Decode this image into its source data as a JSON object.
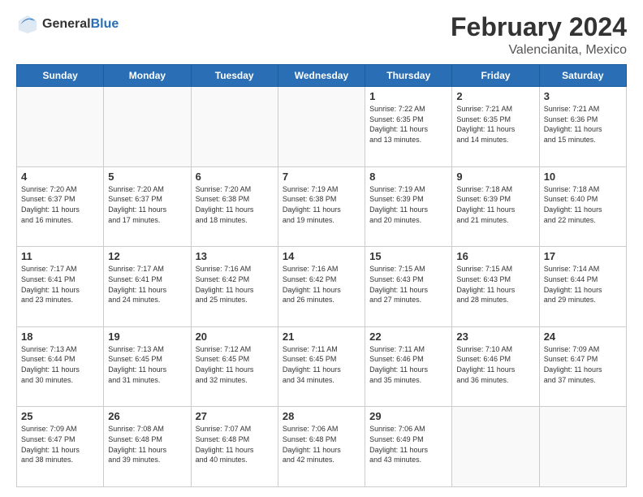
{
  "header": {
    "logo_line1": "General",
    "logo_line2": "Blue",
    "month": "February 2024",
    "location": "Valencianita, Mexico"
  },
  "weekdays": [
    "Sunday",
    "Monday",
    "Tuesday",
    "Wednesday",
    "Thursday",
    "Friday",
    "Saturday"
  ],
  "weeks": [
    [
      {
        "day": "",
        "info": ""
      },
      {
        "day": "",
        "info": ""
      },
      {
        "day": "",
        "info": ""
      },
      {
        "day": "",
        "info": ""
      },
      {
        "day": "1",
        "info": "Sunrise: 7:22 AM\nSunset: 6:35 PM\nDaylight: 11 hours\nand 13 minutes."
      },
      {
        "day": "2",
        "info": "Sunrise: 7:21 AM\nSunset: 6:35 PM\nDaylight: 11 hours\nand 14 minutes."
      },
      {
        "day": "3",
        "info": "Sunrise: 7:21 AM\nSunset: 6:36 PM\nDaylight: 11 hours\nand 15 minutes."
      }
    ],
    [
      {
        "day": "4",
        "info": "Sunrise: 7:20 AM\nSunset: 6:37 PM\nDaylight: 11 hours\nand 16 minutes."
      },
      {
        "day": "5",
        "info": "Sunrise: 7:20 AM\nSunset: 6:37 PM\nDaylight: 11 hours\nand 17 minutes."
      },
      {
        "day": "6",
        "info": "Sunrise: 7:20 AM\nSunset: 6:38 PM\nDaylight: 11 hours\nand 18 minutes."
      },
      {
        "day": "7",
        "info": "Sunrise: 7:19 AM\nSunset: 6:38 PM\nDaylight: 11 hours\nand 19 minutes."
      },
      {
        "day": "8",
        "info": "Sunrise: 7:19 AM\nSunset: 6:39 PM\nDaylight: 11 hours\nand 20 minutes."
      },
      {
        "day": "9",
        "info": "Sunrise: 7:18 AM\nSunset: 6:39 PM\nDaylight: 11 hours\nand 21 minutes."
      },
      {
        "day": "10",
        "info": "Sunrise: 7:18 AM\nSunset: 6:40 PM\nDaylight: 11 hours\nand 22 minutes."
      }
    ],
    [
      {
        "day": "11",
        "info": "Sunrise: 7:17 AM\nSunset: 6:41 PM\nDaylight: 11 hours\nand 23 minutes."
      },
      {
        "day": "12",
        "info": "Sunrise: 7:17 AM\nSunset: 6:41 PM\nDaylight: 11 hours\nand 24 minutes."
      },
      {
        "day": "13",
        "info": "Sunrise: 7:16 AM\nSunset: 6:42 PM\nDaylight: 11 hours\nand 25 minutes."
      },
      {
        "day": "14",
        "info": "Sunrise: 7:16 AM\nSunset: 6:42 PM\nDaylight: 11 hours\nand 26 minutes."
      },
      {
        "day": "15",
        "info": "Sunrise: 7:15 AM\nSunset: 6:43 PM\nDaylight: 11 hours\nand 27 minutes."
      },
      {
        "day": "16",
        "info": "Sunrise: 7:15 AM\nSunset: 6:43 PM\nDaylight: 11 hours\nand 28 minutes."
      },
      {
        "day": "17",
        "info": "Sunrise: 7:14 AM\nSunset: 6:44 PM\nDaylight: 11 hours\nand 29 minutes."
      }
    ],
    [
      {
        "day": "18",
        "info": "Sunrise: 7:13 AM\nSunset: 6:44 PM\nDaylight: 11 hours\nand 30 minutes."
      },
      {
        "day": "19",
        "info": "Sunrise: 7:13 AM\nSunset: 6:45 PM\nDaylight: 11 hours\nand 31 minutes."
      },
      {
        "day": "20",
        "info": "Sunrise: 7:12 AM\nSunset: 6:45 PM\nDaylight: 11 hours\nand 32 minutes."
      },
      {
        "day": "21",
        "info": "Sunrise: 7:11 AM\nSunset: 6:45 PM\nDaylight: 11 hours\nand 34 minutes."
      },
      {
        "day": "22",
        "info": "Sunrise: 7:11 AM\nSunset: 6:46 PM\nDaylight: 11 hours\nand 35 minutes."
      },
      {
        "day": "23",
        "info": "Sunrise: 7:10 AM\nSunset: 6:46 PM\nDaylight: 11 hours\nand 36 minutes."
      },
      {
        "day": "24",
        "info": "Sunrise: 7:09 AM\nSunset: 6:47 PM\nDaylight: 11 hours\nand 37 minutes."
      }
    ],
    [
      {
        "day": "25",
        "info": "Sunrise: 7:09 AM\nSunset: 6:47 PM\nDaylight: 11 hours\nand 38 minutes."
      },
      {
        "day": "26",
        "info": "Sunrise: 7:08 AM\nSunset: 6:48 PM\nDaylight: 11 hours\nand 39 minutes."
      },
      {
        "day": "27",
        "info": "Sunrise: 7:07 AM\nSunset: 6:48 PM\nDaylight: 11 hours\nand 40 minutes."
      },
      {
        "day": "28",
        "info": "Sunrise: 7:06 AM\nSunset: 6:48 PM\nDaylight: 11 hours\nand 42 minutes."
      },
      {
        "day": "29",
        "info": "Sunrise: 7:06 AM\nSunset: 6:49 PM\nDaylight: 11 hours\nand 43 minutes."
      },
      {
        "day": "",
        "info": ""
      },
      {
        "day": "",
        "info": ""
      }
    ]
  ]
}
